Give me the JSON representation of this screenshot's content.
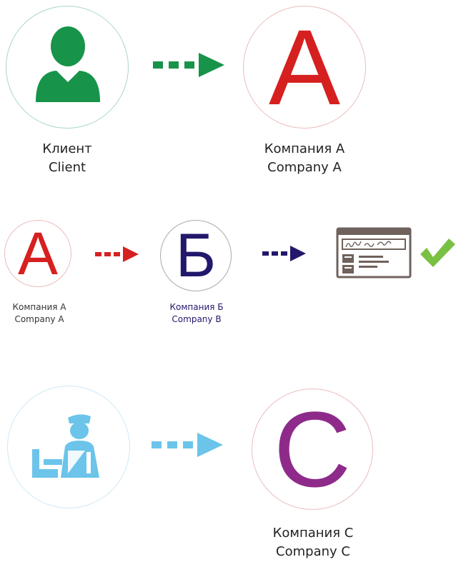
{
  "colors": {
    "green": "#17934a",
    "red": "#d6201f",
    "navy": "#22186b",
    "light_blue": "#6cc4ea",
    "purple": "#8e2b8a",
    "check": "#7ac043",
    "card_brown": "#6f625c"
  },
  "row1": {
    "client": {
      "label_ru": "Клиент",
      "label_en": "Client",
      "icon": "person-icon"
    },
    "company_a": {
      "letter": "A",
      "label_ru": "Компания А",
      "label_en": "Company A"
    }
  },
  "row2": {
    "company_a": {
      "letter": "A",
      "label_ru": "Компания А",
      "label_en": "Company A"
    },
    "company_b": {
      "letter": "Б",
      "label_ru": "Компания Б",
      "label_en": "Company B"
    },
    "card": {
      "icon": "signature-card-icon"
    },
    "check": {
      "icon": "checkmark-icon"
    }
  },
  "row3": {
    "customs": {
      "icon": "customs-officer-icon"
    },
    "company_c": {
      "letter": "C",
      "label_ru": "Компания С",
      "label_en": "Company C"
    }
  }
}
